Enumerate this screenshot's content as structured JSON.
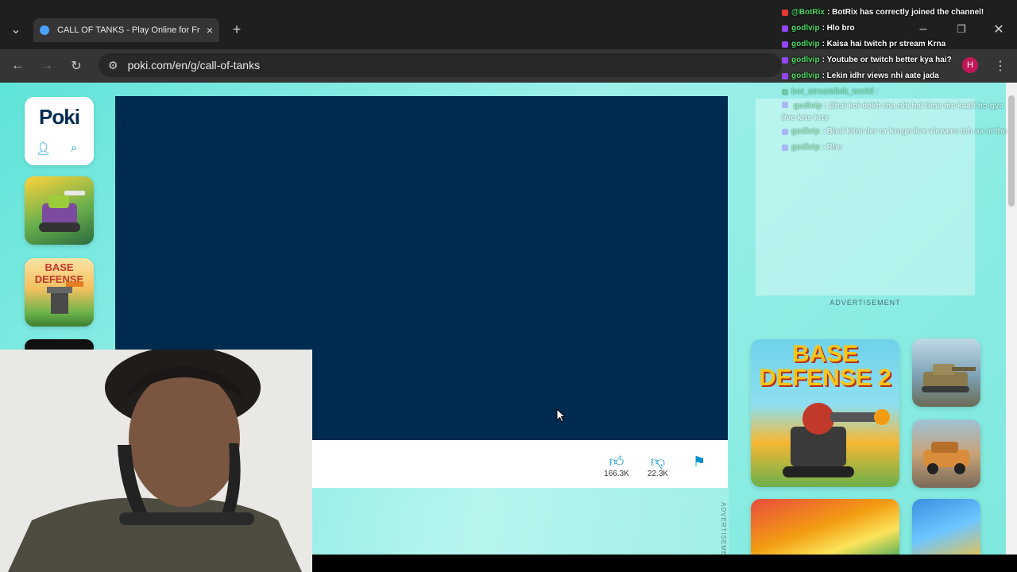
{
  "browser": {
    "tab_title": "CALL OF TANKS - Play Online for Free",
    "new_tab": "+",
    "close_tab": "×",
    "url": "poki.com/en/g/call-of-tanks",
    "profile_initial": "H"
  },
  "site": {
    "logo": "Poki",
    "advertisement_label": "ADVERTISEMENT",
    "vertical_ad_label": "ADVERTISEMENT",
    "likes": "166.3K",
    "dislikes": "22.3K"
  },
  "side_games": [
    "BASE DEFENSE",
    "BASE DEFENSE 2"
  ],
  "chat": [
    {
      "user": "@BotRix",
      "text": "BotRix has correctly joined the channel!",
      "badge": "bot"
    },
    {
      "user": "godlvip",
      "text": "Hlo bro",
      "badge": "sub"
    },
    {
      "user": "godlvip",
      "text": "Kaisa hai twitch pr stream Krna",
      "badge": "sub"
    },
    {
      "user": "godlvip",
      "text": "Youtube or twitch better kya hai?",
      "badge": "sub"
    },
    {
      "user": "godlvip",
      "text": "Lekin idhr views nhi aate jada",
      "badge": "sub"
    },
    {
      "user": "bot_streamlink_world",
      "text": "",
      "badge": "bot",
      "faint": true
    },
    {
      "user": "godlvip",
      "text": "Bhai koi dekh rha nhi hai time me kaafi ho gya live krte krte",
      "badge": "sub",
      "faint": true
    },
    {
      "user": "godlvip",
      "text": "Bhai kitni der or kroge live viewers toh aa ni the",
      "badge": "sub",
      "faint": true
    },
    {
      "user": "godlvip",
      "text": "Rhe",
      "badge": "sub",
      "faint": true
    }
  ],
  "colors": {
    "game_bg": "#002b50",
    "page_bg": "#5fe3d8",
    "chat_user": "#4cd964",
    "accent": "#0092cc"
  }
}
